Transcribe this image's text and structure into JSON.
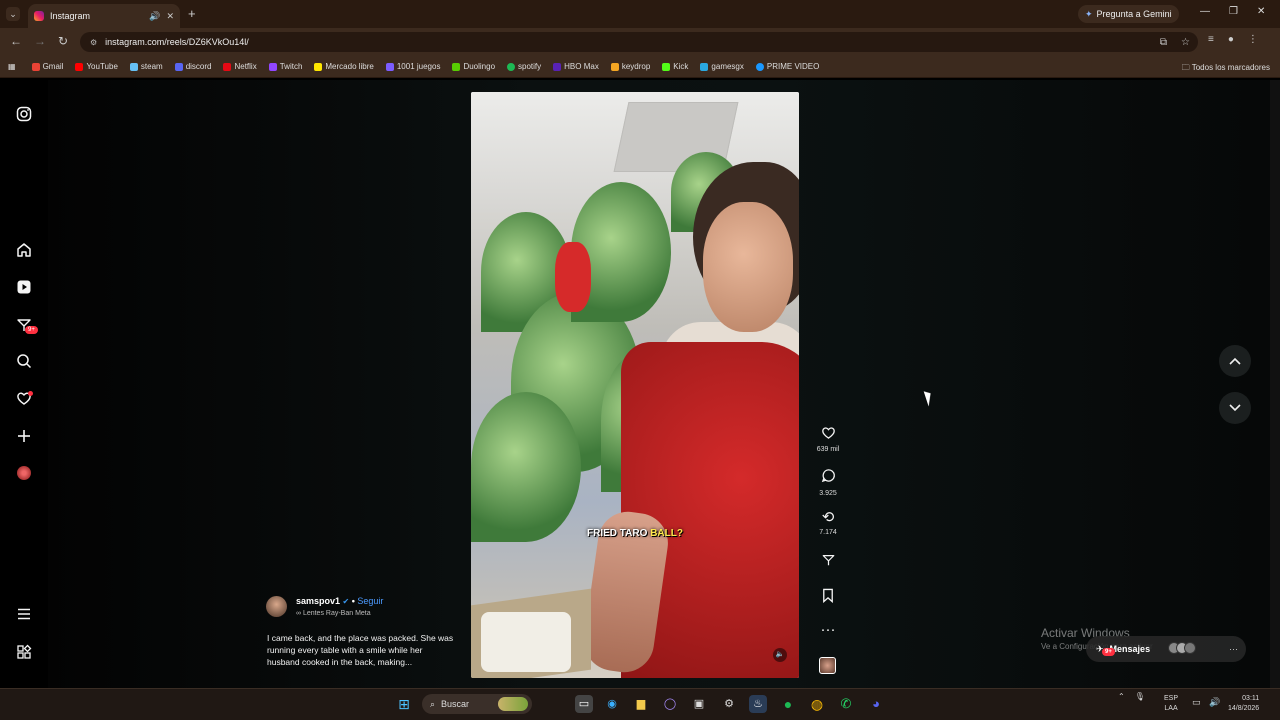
{
  "browser": {
    "tab_title": "Instagram",
    "url": "instagram.com/reels/DZ6KVkOu14l/",
    "gemini_label": "Pregunta a Gemini",
    "bookmarks": [
      {
        "label": "Gmail",
        "color": "#ea4335"
      },
      {
        "label": "YouTube",
        "color": "#ff0000"
      },
      {
        "label": "steam",
        "color": "#1b2838"
      },
      {
        "label": "discord",
        "color": "#5865f2"
      },
      {
        "label": "Netflix",
        "color": "#e50914"
      },
      {
        "label": "Twitch",
        "color": "#9146ff"
      },
      {
        "label": "Mercado libre",
        "color": "#ffe600"
      },
      {
        "label": "1001 juegos",
        "color": "#7b5cff"
      },
      {
        "label": "Duolingo",
        "color": "#58cc02"
      },
      {
        "label": "spotify",
        "color": "#1db954"
      },
      {
        "label": "HBO Max",
        "color": "#5822b4"
      },
      {
        "label": "keydrop",
        "color": "#f5a623"
      },
      {
        "label": "Kick",
        "color": "#53fc18"
      },
      {
        "label": "gamesgx",
        "color": "#2aa8e0"
      },
      {
        "label": "PRIME VIDEO",
        "color": "#1a98ff"
      }
    ],
    "all_bookmarks": "Todos los marcadores"
  },
  "sidebar": {
    "messages_badge": "9+"
  },
  "reel": {
    "caption_prefix": "FRIED TARO ",
    "caption_highlight": "BALL?",
    "likes": "639 mil",
    "comments": "3.925",
    "reposts": "7.174",
    "author": "samspov1",
    "follow": "Seguir",
    "sub": "Lentes Ray-Ban Meta",
    "description": "I came back, and the place was packed. She was running every table with a smile while her husband cooked in the back, making..."
  },
  "overlay": {
    "activate_title": "Activar Windows",
    "activate_sub": "Ve a Configuración para activar",
    "messages_label": "Mensajes",
    "messages_badge": "9+"
  },
  "taskbar": {
    "search_placeholder": "Buscar",
    "lang_top": "ESP",
    "lang_bottom": "LAA",
    "time": "03:11",
    "date": "14/8/2026"
  }
}
